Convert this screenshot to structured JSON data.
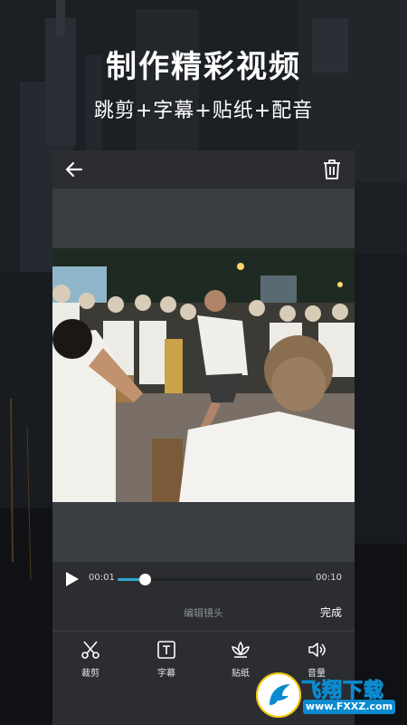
{
  "promo": {
    "headline": "制作精彩视频",
    "subline": "跳剪+字幕+贴纸+配音"
  },
  "topbar": {
    "back_icon": "arrow-left-icon",
    "delete_icon": "trash-icon"
  },
  "player": {
    "current_time": "00:01",
    "total_time": "00:10",
    "progress": 0.14
  },
  "editbar": {
    "title": "编辑镜头",
    "done_label": "完成"
  },
  "tools": [
    {
      "label": "裁剪",
      "icon": "scissors-icon"
    },
    {
      "label": "字幕",
      "icon": "text-box-icon"
    },
    {
      "label": "贴纸",
      "icon": "lotus-icon"
    },
    {
      "label": "音量",
      "icon": "speaker-icon"
    }
  ],
  "watermark": {
    "brand": "飞翔下载",
    "url": "www.FXXZ.com"
  },
  "colors": {
    "accent": "#2fa8d6",
    "panel": "#2b2d30",
    "preview_bg": "#3a3d41"
  }
}
